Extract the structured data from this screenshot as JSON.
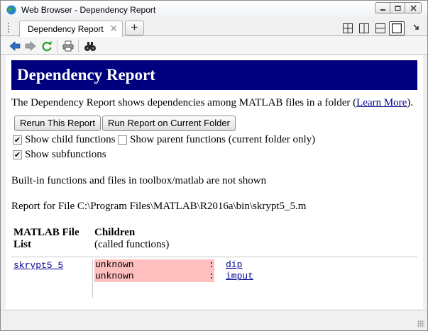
{
  "window": {
    "title": "Web Browser - Dependency Report",
    "controls": [
      "minimize-icon",
      "restore-icon",
      "close-icon"
    ]
  },
  "tabs": [
    {
      "label": "Dependency Report",
      "close": "✕",
      "active": true
    }
  ],
  "new_tab_label": "+",
  "layout_buttons": [
    "tile-grid-icon",
    "split-vertical-icon",
    "split-horizontal-icon",
    "maximize-panel-icon"
  ],
  "toolbar": {
    "icons": [
      "back-arrow-icon",
      "forward-arrow-icon",
      "refresh-icon",
      "print-icon",
      "find-binoculars-icon"
    ]
  },
  "report": {
    "heading": "Dependency Report",
    "intro_before": "The Dependency Report shows dependencies among MATLAB files in a folder (",
    "intro_link": "Learn More",
    "intro_after": ").",
    "buttons": {
      "rerun": "Rerun This Report",
      "run_current": "Run Report on Current Folder"
    },
    "options": {
      "child_functions": {
        "label": "Show child functions",
        "checked": true
      },
      "parent_functions": {
        "label": "Show parent functions (current folder only)",
        "checked": false
      },
      "subfunctions": {
        "label": "Show subfunctions",
        "checked": true
      }
    },
    "note": "Built-in functions and files in toolbox/matlab are not shown",
    "file_line": "Report for File C:\\Program Files\\MATLAB\\R2016a\\bin\\skrypt5_5.m",
    "table": {
      "col1_header_line1": "MATLAB File",
      "col1_header_line2": "List",
      "col2_header_line1": "Children",
      "col2_header_line2": "(called functions)",
      "file": "skrypt5_5",
      "children": [
        {
          "type": "unknown",
          "sep": ":",
          "name": "dip"
        },
        {
          "type": "unknown",
          "sep": ":",
          "name": "imput"
        }
      ]
    }
  },
  "colors": {
    "banner_bg": "#00007f",
    "unknown_highlight": "#ffbfbf",
    "link": "#00008b"
  }
}
